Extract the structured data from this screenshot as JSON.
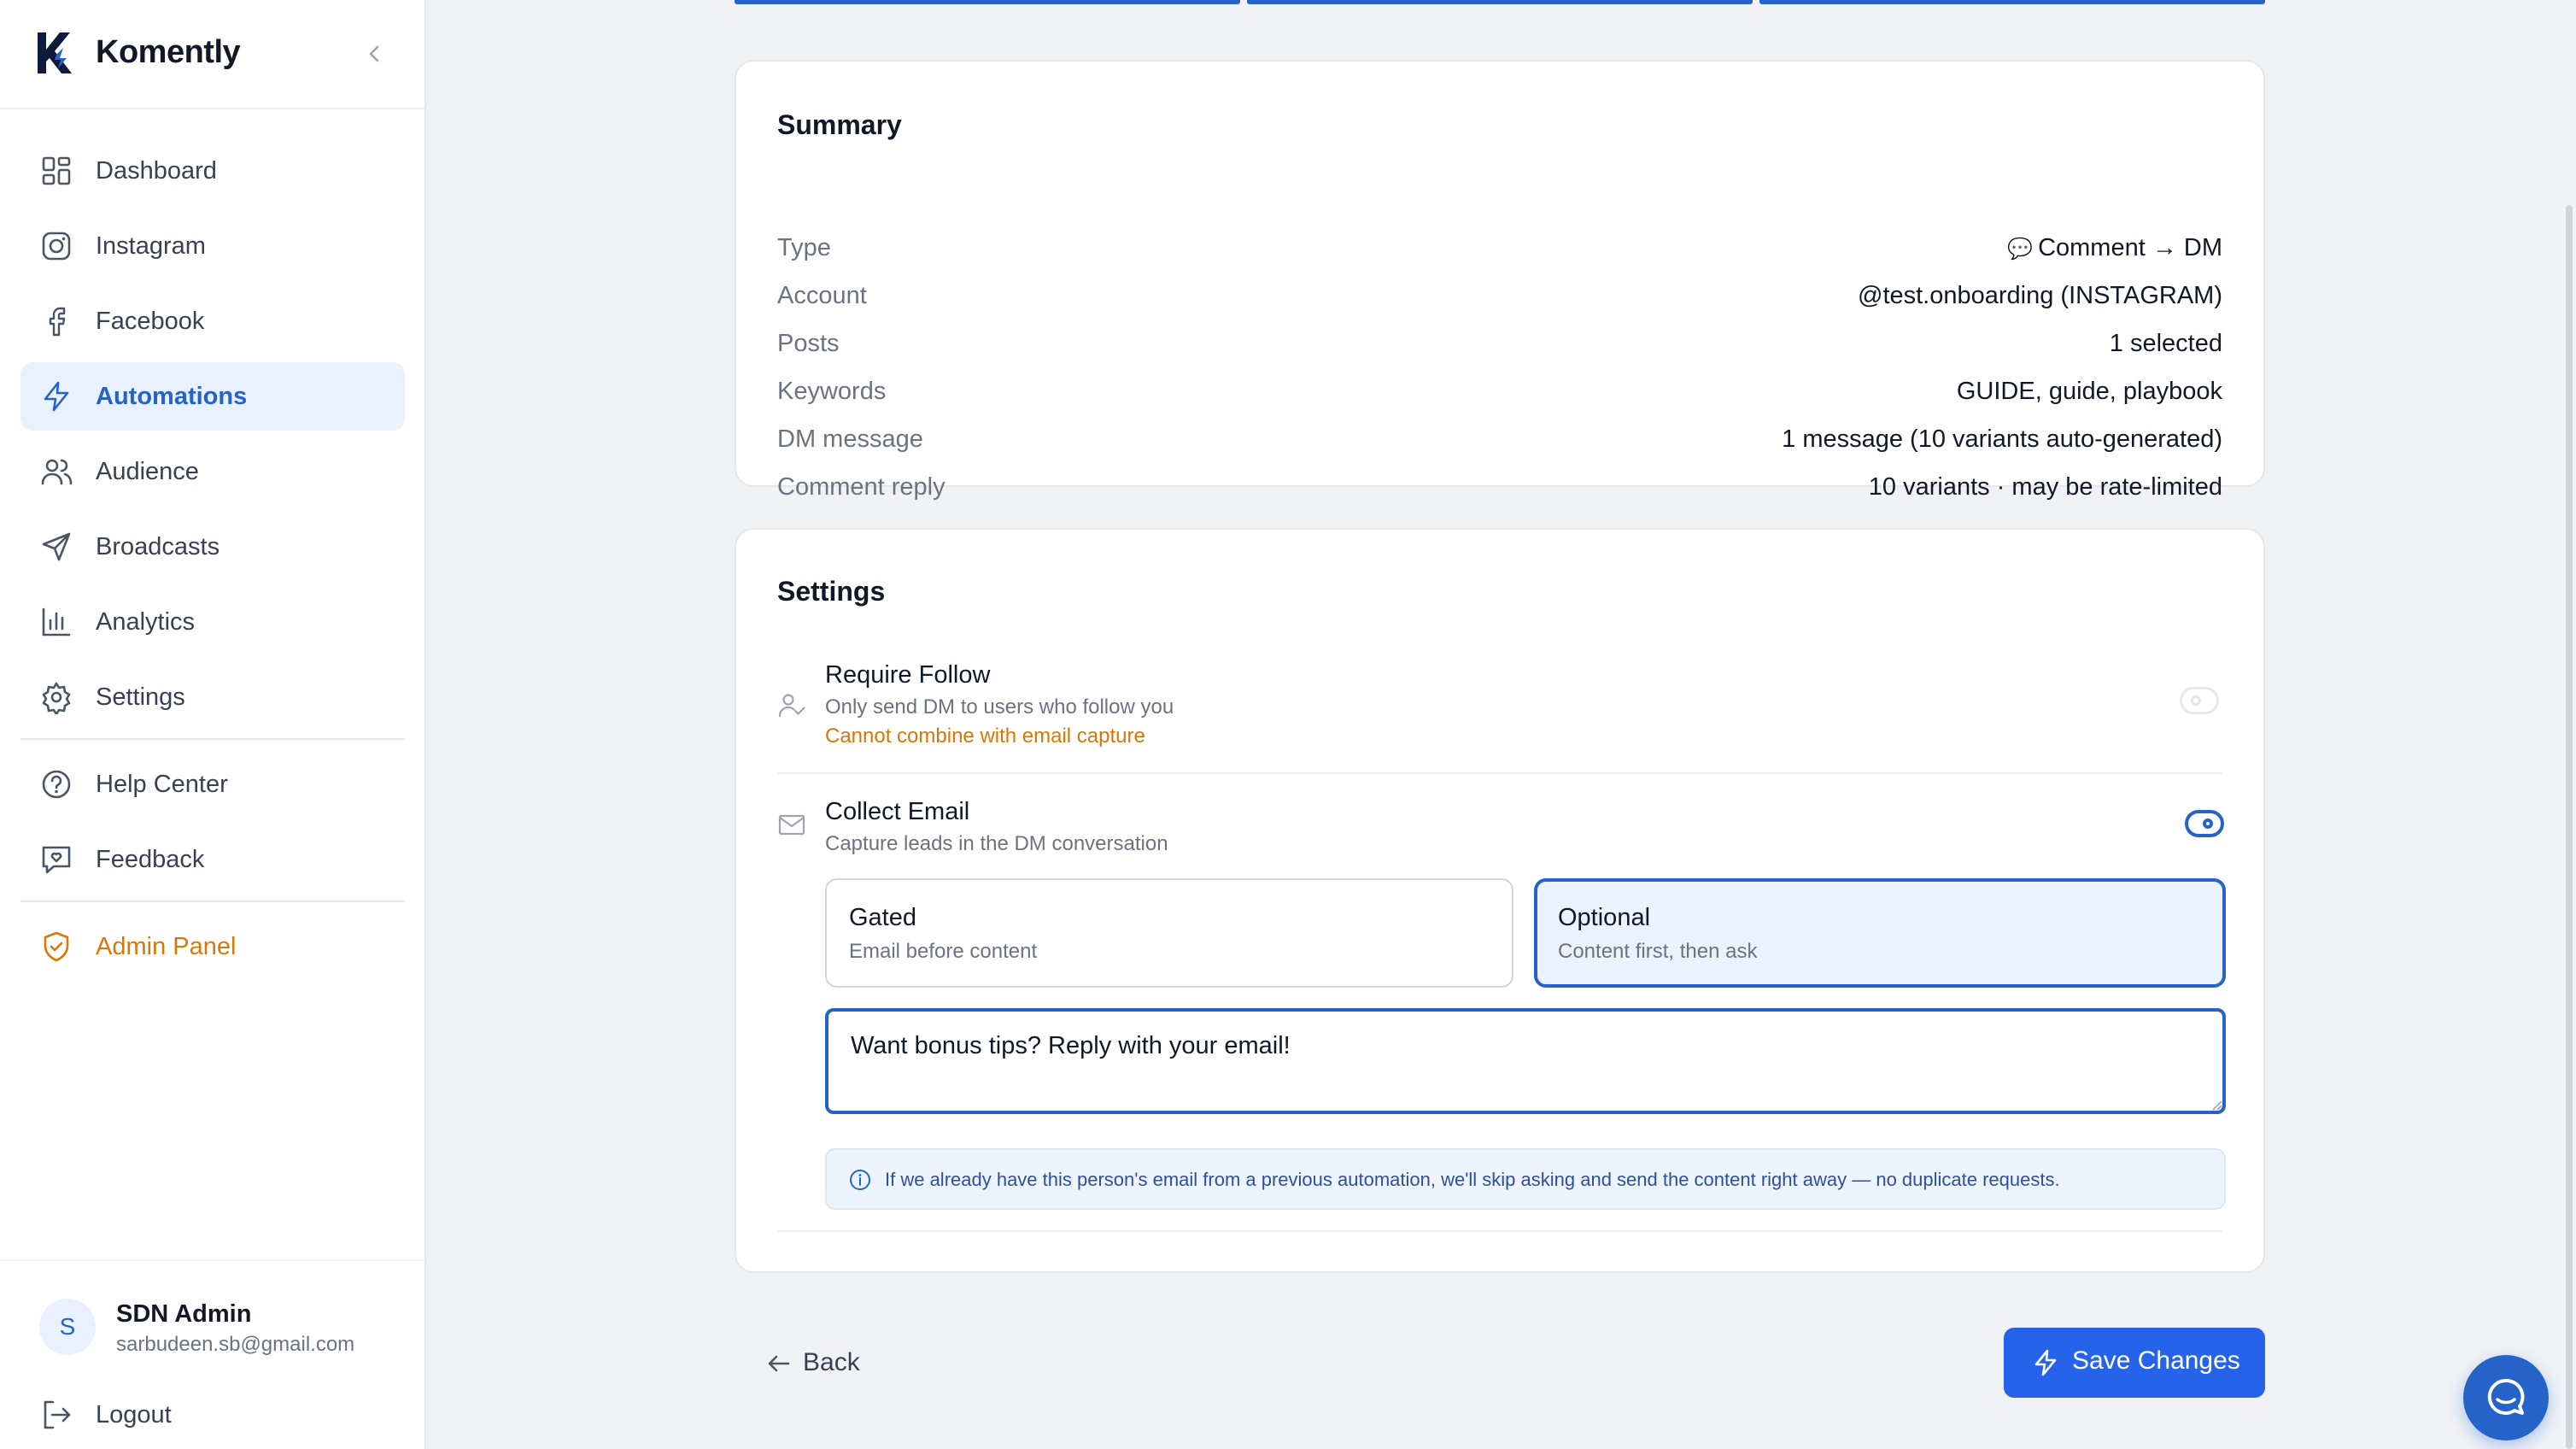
{
  "app": {
    "name": "Komently"
  },
  "sidebar": {
    "items": [
      {
        "label": "Dashboard",
        "icon": "dashboard-icon"
      },
      {
        "label": "Instagram",
        "icon": "instagram-icon"
      },
      {
        "label": "Facebook",
        "icon": "facebook-icon"
      },
      {
        "label": "Automations",
        "icon": "lightning-icon",
        "active": true
      },
      {
        "label": "Audience",
        "icon": "users-icon"
      },
      {
        "label": "Broadcasts",
        "icon": "send-icon"
      },
      {
        "label": "Analytics",
        "icon": "bar-chart-icon"
      },
      {
        "label": "Settings",
        "icon": "gear-icon"
      }
    ],
    "support": [
      {
        "label": "Help Center",
        "icon": "help-circle-icon"
      },
      {
        "label": "Feedback",
        "icon": "feedback-icon"
      }
    ],
    "admin": {
      "label": "Admin Panel",
      "icon": "shield-icon"
    },
    "user": {
      "initial": "S",
      "name": "SDN Admin",
      "email": "sarbudeen.sb@gmail.com"
    },
    "logout": {
      "label": "Logout",
      "icon": "logout-icon"
    }
  },
  "summary": {
    "title": "Summary",
    "rows": [
      {
        "key": "Type",
        "emoji": "💬",
        "value": "Comment → DM"
      },
      {
        "key": "Account",
        "value": "@test.onboarding (INSTAGRAM)"
      },
      {
        "key": "Posts",
        "value": "1 selected"
      },
      {
        "key": "Keywords",
        "value": "GUIDE, guide, playbook"
      },
      {
        "key": "DM message",
        "value": "1 message (10 variants auto-generated)"
      },
      {
        "key": "Comment reply",
        "value": "10 variants · may be rate-limited"
      }
    ]
  },
  "settings": {
    "title": "Settings",
    "require_follow": {
      "title": "Require Follow",
      "desc": "Only send DM to users who follow you",
      "warning": "Cannot combine with email capture",
      "enabled": false
    },
    "collect_email": {
      "title": "Collect Email",
      "desc": "Capture leads in the DM conversation",
      "enabled": true,
      "modes": [
        {
          "title": "Gated",
          "desc": "Email before content",
          "selected": false
        },
        {
          "title": "Optional",
          "desc": "Content first, then ask",
          "selected": true
        }
      ],
      "message_value": "Want bonus tips? Reply with your email!",
      "info": "If we already have this person's email from a previous automation, we'll skip asking and send the content right away — no duplicate requests."
    }
  },
  "footer": {
    "back_label": "Back",
    "save_label": "Save Changes"
  },
  "colors": {
    "accent": "#2563c9",
    "warning": "#d97706",
    "page_bg": "#f0f2f6"
  }
}
